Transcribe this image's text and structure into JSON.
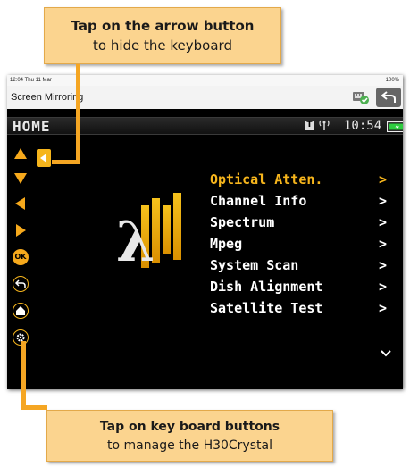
{
  "callouts": {
    "top": {
      "bold": "Tap on the arrow button",
      "normal": "to hide the keyboard"
    },
    "bottom": {
      "bold": "Tap on key board buttons",
      "normal": "to manage the H30Crystal"
    }
  },
  "ios_status": {
    "time": "12:04  Thu 11 Mar",
    "battery": "100%"
  },
  "app": {
    "title": "Screen Mirroring"
  },
  "device": {
    "home_label": "HOME",
    "clock": "10:54",
    "t_badge": "T"
  },
  "menu": {
    "items": [
      {
        "label": "Optical Atten.",
        "arrow": ">"
      },
      {
        "label": "Channel Info",
        "arrow": ">"
      },
      {
        "label": "Spectrum",
        "arrow": ">"
      },
      {
        "label": "Mpeg",
        "arrow": ">"
      },
      {
        "label": "System Scan",
        "arrow": ">"
      },
      {
        "label": "Dish Alignment",
        "arrow": ">"
      },
      {
        "label": "Satellite Test",
        "arrow": ">"
      }
    ]
  },
  "keys": {
    "ok_label": "OK"
  },
  "colors": {
    "accent": "#f6b51c",
    "callout_bg": "#fbd48f"
  }
}
